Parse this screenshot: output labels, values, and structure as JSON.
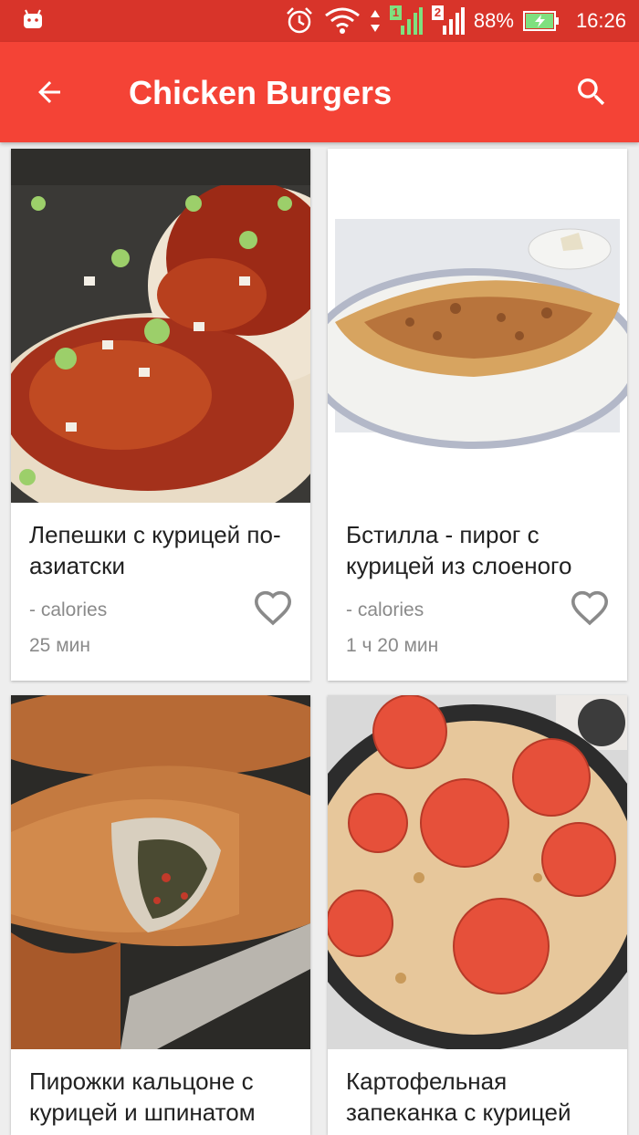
{
  "status_bar": {
    "battery_percent": "88%",
    "time": "16:26",
    "sim1_label": "1",
    "sim2_label": "2"
  },
  "toolbar": {
    "title": "Chicken Burgers",
    "back_icon": "arrow-back-icon",
    "search_icon": "search-icon"
  },
  "recipes": [
    {
      "name": "Лепешки с курицей по-азиатски",
      "calories": "- calories",
      "time": "25 мин"
    },
    {
      "name": "Бстилла - пирог с курицей из слоеного",
      "calories": "- calories",
      "time": "1 ч 20 мин"
    },
    {
      "name": "Пирожки кальцоне с курицей и шпинатом",
      "calories": "",
      "time": ""
    },
    {
      "name": "Картофельная запеканка с курицей",
      "calories": "",
      "time": ""
    }
  ],
  "colors": {
    "status_bar": "#d8342a",
    "toolbar": "#f44336",
    "background": "#eeeeee",
    "secondary_text": "#8a8a8a"
  }
}
